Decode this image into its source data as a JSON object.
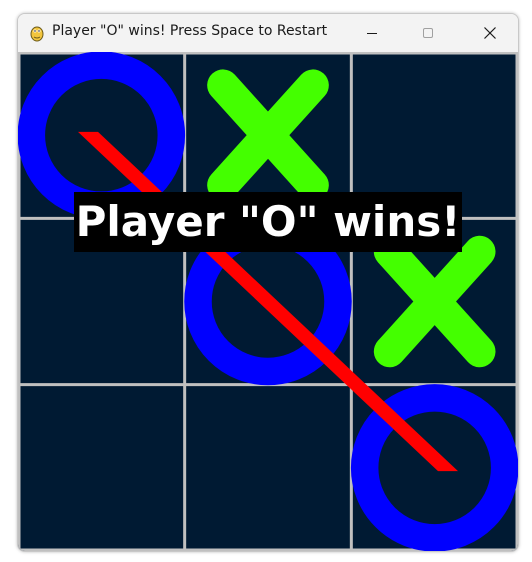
{
  "window": {
    "title": "Player \"O\" wins! Press Space to Restart",
    "app_icon": "pygame-snake-icon",
    "controls": [
      "minimize-icon",
      "maximize-icon",
      "close-icon"
    ]
  },
  "game": {
    "grid_size": 3,
    "board": [
      [
        "O",
        "X",
        ""
      ],
      [
        "",
        "O",
        "X"
      ],
      [
        "",
        "",
        "O"
      ]
    ],
    "winner": "O",
    "win_line": "diagonal",
    "win_message": "Player \"O\" wins!"
  },
  "colors": {
    "board_background": "#001a33",
    "grid_lines": "#c0c0c0",
    "o_mark": "#0000ff",
    "x_mark": "#44ff00",
    "win_line": "#ff0000",
    "banner_background": "#000000",
    "banner_text": "#ffffff"
  }
}
